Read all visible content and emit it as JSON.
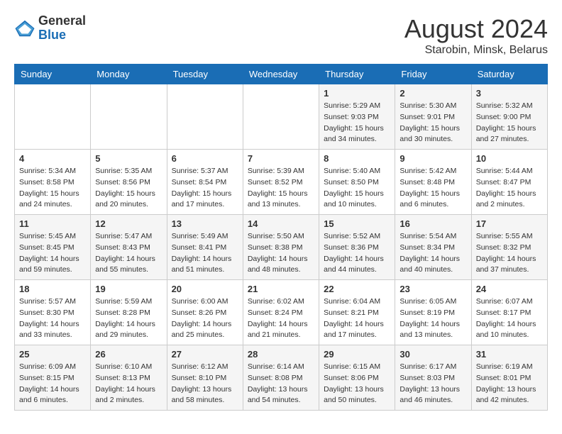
{
  "header": {
    "logo_general": "General",
    "logo_blue": "Blue",
    "month_year": "August 2024",
    "location": "Starobin, Minsk, Belarus"
  },
  "days_of_week": [
    "Sunday",
    "Monday",
    "Tuesday",
    "Wednesday",
    "Thursday",
    "Friday",
    "Saturday"
  ],
  "weeks": [
    [
      {
        "day": "",
        "sunrise": "",
        "sunset": "",
        "daylight": ""
      },
      {
        "day": "",
        "sunrise": "",
        "sunset": "",
        "daylight": ""
      },
      {
        "day": "",
        "sunrise": "",
        "sunset": "",
        "daylight": ""
      },
      {
        "day": "",
        "sunrise": "",
        "sunset": "",
        "daylight": ""
      },
      {
        "day": "1",
        "sunrise": "Sunrise: 5:29 AM",
        "sunset": "Sunset: 9:03 PM",
        "daylight": "Daylight: 15 hours and 34 minutes."
      },
      {
        "day": "2",
        "sunrise": "Sunrise: 5:30 AM",
        "sunset": "Sunset: 9:01 PM",
        "daylight": "Daylight: 15 hours and 30 minutes."
      },
      {
        "day": "3",
        "sunrise": "Sunrise: 5:32 AM",
        "sunset": "Sunset: 9:00 PM",
        "daylight": "Daylight: 15 hours and 27 minutes."
      }
    ],
    [
      {
        "day": "4",
        "sunrise": "Sunrise: 5:34 AM",
        "sunset": "Sunset: 8:58 PM",
        "daylight": "Daylight: 15 hours and 24 minutes."
      },
      {
        "day": "5",
        "sunrise": "Sunrise: 5:35 AM",
        "sunset": "Sunset: 8:56 PM",
        "daylight": "Daylight: 15 hours and 20 minutes."
      },
      {
        "day": "6",
        "sunrise": "Sunrise: 5:37 AM",
        "sunset": "Sunset: 8:54 PM",
        "daylight": "Daylight: 15 hours and 17 minutes."
      },
      {
        "day": "7",
        "sunrise": "Sunrise: 5:39 AM",
        "sunset": "Sunset: 8:52 PM",
        "daylight": "Daylight: 15 hours and 13 minutes."
      },
      {
        "day": "8",
        "sunrise": "Sunrise: 5:40 AM",
        "sunset": "Sunset: 8:50 PM",
        "daylight": "Daylight: 15 hours and 10 minutes."
      },
      {
        "day": "9",
        "sunrise": "Sunrise: 5:42 AM",
        "sunset": "Sunset: 8:48 PM",
        "daylight": "Daylight: 15 hours and 6 minutes."
      },
      {
        "day": "10",
        "sunrise": "Sunrise: 5:44 AM",
        "sunset": "Sunset: 8:47 PM",
        "daylight": "Daylight: 15 hours and 2 minutes."
      }
    ],
    [
      {
        "day": "11",
        "sunrise": "Sunrise: 5:45 AM",
        "sunset": "Sunset: 8:45 PM",
        "daylight": "Daylight: 14 hours and 59 minutes."
      },
      {
        "day": "12",
        "sunrise": "Sunrise: 5:47 AM",
        "sunset": "Sunset: 8:43 PM",
        "daylight": "Daylight: 14 hours and 55 minutes."
      },
      {
        "day": "13",
        "sunrise": "Sunrise: 5:49 AM",
        "sunset": "Sunset: 8:41 PM",
        "daylight": "Daylight: 14 hours and 51 minutes."
      },
      {
        "day": "14",
        "sunrise": "Sunrise: 5:50 AM",
        "sunset": "Sunset: 8:38 PM",
        "daylight": "Daylight: 14 hours and 48 minutes."
      },
      {
        "day": "15",
        "sunrise": "Sunrise: 5:52 AM",
        "sunset": "Sunset: 8:36 PM",
        "daylight": "Daylight: 14 hours and 44 minutes."
      },
      {
        "day": "16",
        "sunrise": "Sunrise: 5:54 AM",
        "sunset": "Sunset: 8:34 PM",
        "daylight": "Daylight: 14 hours and 40 minutes."
      },
      {
        "day": "17",
        "sunrise": "Sunrise: 5:55 AM",
        "sunset": "Sunset: 8:32 PM",
        "daylight": "Daylight: 14 hours and 37 minutes."
      }
    ],
    [
      {
        "day": "18",
        "sunrise": "Sunrise: 5:57 AM",
        "sunset": "Sunset: 8:30 PM",
        "daylight": "Daylight: 14 hours and 33 minutes."
      },
      {
        "day": "19",
        "sunrise": "Sunrise: 5:59 AM",
        "sunset": "Sunset: 8:28 PM",
        "daylight": "Daylight: 14 hours and 29 minutes."
      },
      {
        "day": "20",
        "sunrise": "Sunrise: 6:00 AM",
        "sunset": "Sunset: 8:26 PM",
        "daylight": "Daylight: 14 hours and 25 minutes."
      },
      {
        "day": "21",
        "sunrise": "Sunrise: 6:02 AM",
        "sunset": "Sunset: 8:24 PM",
        "daylight": "Daylight: 14 hours and 21 minutes."
      },
      {
        "day": "22",
        "sunrise": "Sunrise: 6:04 AM",
        "sunset": "Sunset: 8:21 PM",
        "daylight": "Daylight: 14 hours and 17 minutes."
      },
      {
        "day": "23",
        "sunrise": "Sunrise: 6:05 AM",
        "sunset": "Sunset: 8:19 PM",
        "daylight": "Daylight: 14 hours and 13 minutes."
      },
      {
        "day": "24",
        "sunrise": "Sunrise: 6:07 AM",
        "sunset": "Sunset: 8:17 PM",
        "daylight": "Daylight: 14 hours and 10 minutes."
      }
    ],
    [
      {
        "day": "25",
        "sunrise": "Sunrise: 6:09 AM",
        "sunset": "Sunset: 8:15 PM",
        "daylight": "Daylight: 14 hours and 6 minutes."
      },
      {
        "day": "26",
        "sunrise": "Sunrise: 6:10 AM",
        "sunset": "Sunset: 8:13 PM",
        "daylight": "Daylight: 14 hours and 2 minutes."
      },
      {
        "day": "27",
        "sunrise": "Sunrise: 6:12 AM",
        "sunset": "Sunset: 8:10 PM",
        "daylight": "Daylight: 13 hours and 58 minutes."
      },
      {
        "day": "28",
        "sunrise": "Sunrise: 6:14 AM",
        "sunset": "Sunset: 8:08 PM",
        "daylight": "Daylight: 13 hours and 54 minutes."
      },
      {
        "day": "29",
        "sunrise": "Sunrise: 6:15 AM",
        "sunset": "Sunset: 8:06 PM",
        "daylight": "Daylight: 13 hours and 50 minutes."
      },
      {
        "day": "30",
        "sunrise": "Sunrise: 6:17 AM",
        "sunset": "Sunset: 8:03 PM",
        "daylight": "Daylight: 13 hours and 46 minutes."
      },
      {
        "day": "31",
        "sunrise": "Sunrise: 6:19 AM",
        "sunset": "Sunset: 8:01 PM",
        "daylight": "Daylight: 13 hours and 42 minutes."
      }
    ]
  ]
}
